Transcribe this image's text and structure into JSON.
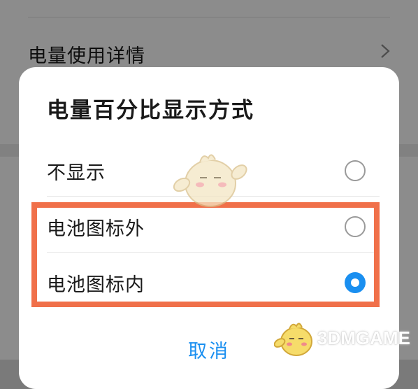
{
  "background": {
    "row_label": "电量使用详情",
    "chevron_icon": "chevron-right-icon"
  },
  "dialog": {
    "title": "电量百分比显示方式",
    "options": [
      {
        "label": "不显示",
        "checked": false
      },
      {
        "label": "电池图标外",
        "checked": false
      },
      {
        "label": "电池图标内",
        "checked": true
      }
    ],
    "cancel_label": "取消"
  },
  "watermark": {
    "text": "3DMGAME"
  },
  "colors": {
    "accent": "#1a8ff0",
    "highlight": "#f0704a",
    "radio_border": "#9a9a9a"
  }
}
